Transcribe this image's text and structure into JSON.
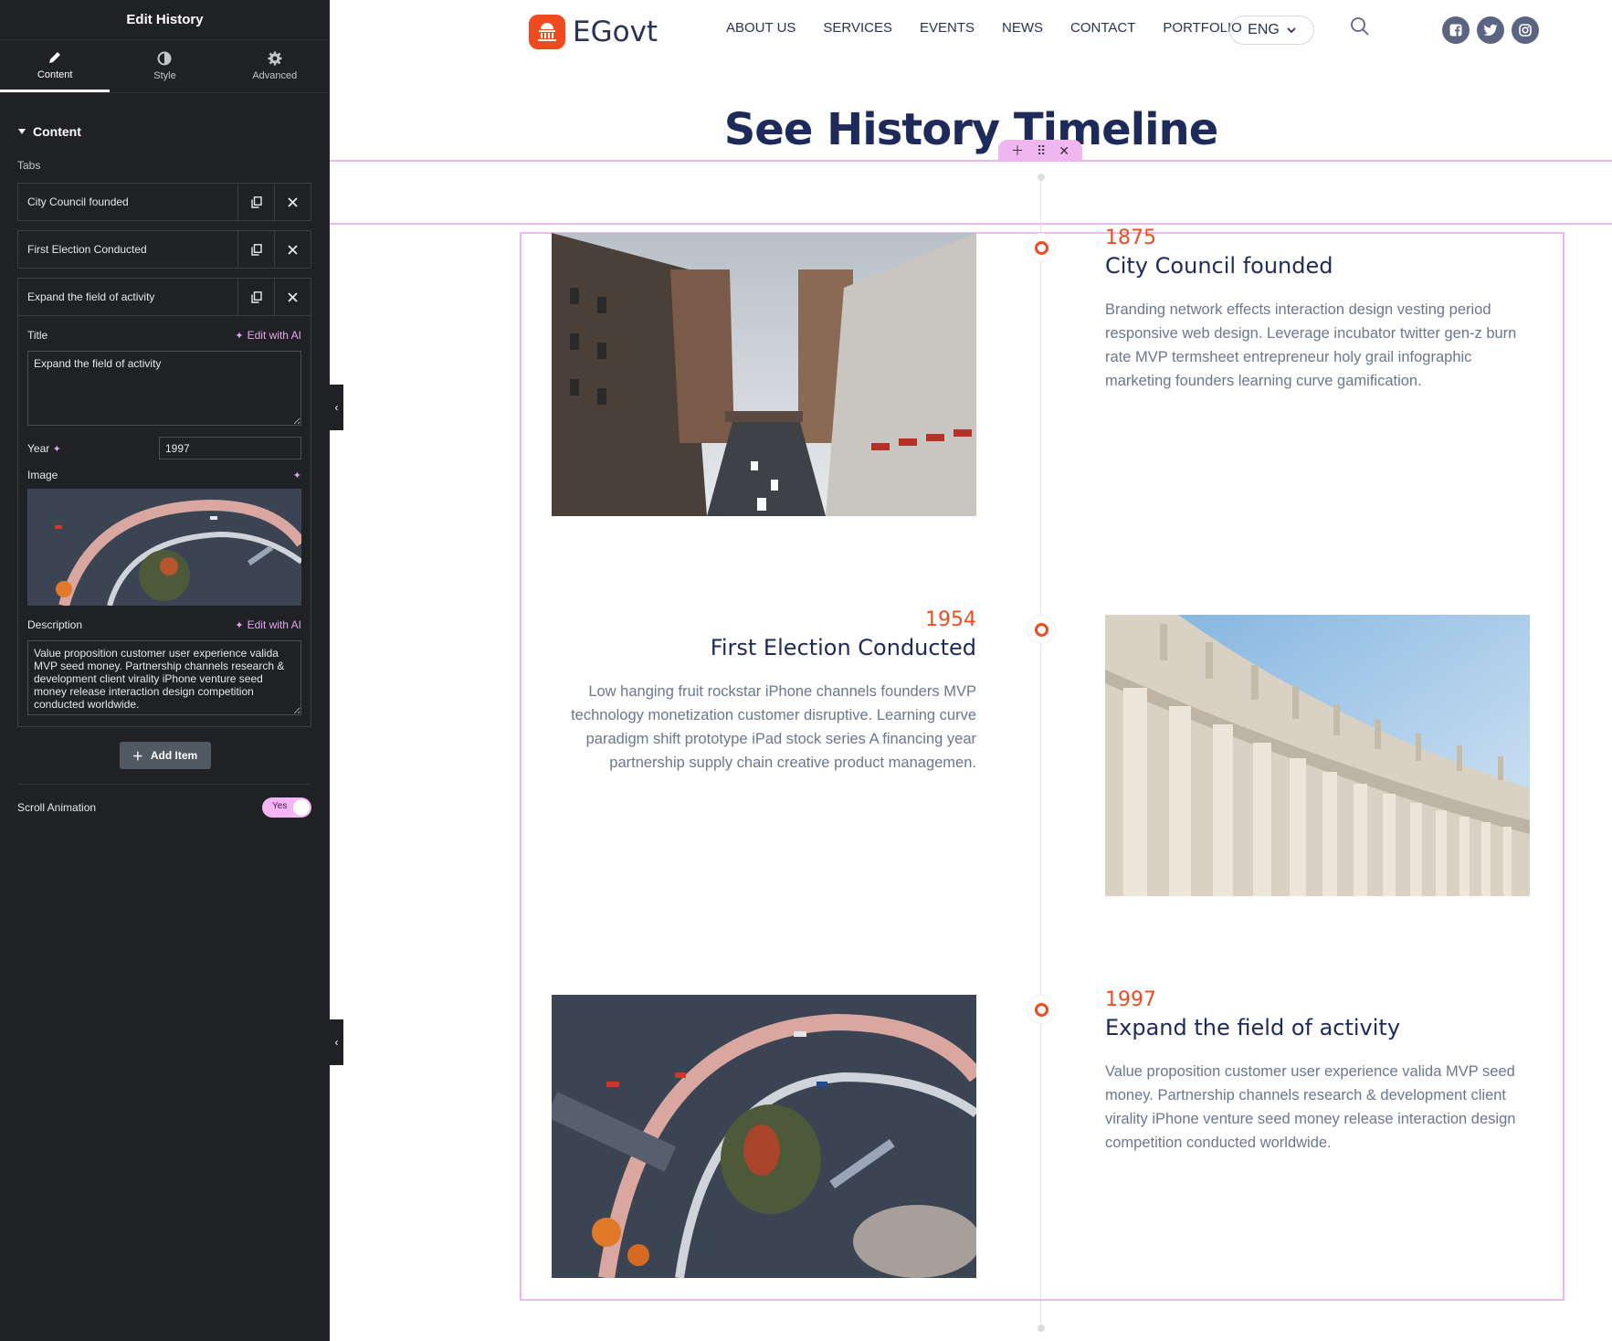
{
  "sidebar": {
    "header_title": "Edit History",
    "tabs": [
      {
        "label": "Content",
        "icon": "pencil-icon"
      },
      {
        "label": "Style",
        "icon": "contrast-icon"
      },
      {
        "label": "Advanced",
        "icon": "gear-icon"
      }
    ],
    "section_title": "Content",
    "tabs_label": "Tabs",
    "items": [
      {
        "title": "City Council founded"
      },
      {
        "title": "First Election Conducted"
      },
      {
        "title": "Expand the field of activity"
      }
    ],
    "open_item": {
      "title_label": "Title",
      "title_value": "Expand the field of activity",
      "edit_ai_label": "Edit with AI",
      "year_label": "Year",
      "year_value": "1997",
      "image_label": "Image",
      "description_label": "Description",
      "description_value": "Value proposition customer user experience valida MVP seed money. Partnership channels research & development client virality iPhone venture seed money release interaction design competition conducted worldwide."
    },
    "add_item_label": "Add Item",
    "scroll_animation_label": "Scroll Animation",
    "scroll_animation_value": "Yes"
  },
  "nav": {
    "logo_text": "EGovt",
    "links": [
      "ABOUT US",
      "SERVICES",
      "EVENTS",
      "NEWS",
      "CONTACT",
      "PORTFOLIO"
    ],
    "language": "ENG",
    "socials": [
      "facebook-icon",
      "twitter-icon",
      "instagram-icon"
    ]
  },
  "section": {
    "title": "See History Timeline"
  },
  "timeline": [
    {
      "year": "1875",
      "title": "City Council founded",
      "description": "Branding network effects interaction design vesting period responsive web design. Leverage incubator twitter gen-z burn rate MVP termsheet entrepreneur holy grail infographic marketing founders learning curve gamification."
    },
    {
      "year": "1954",
      "title": "First Election Conducted",
      "description": "Low hanging fruit rockstar iPhone channels founders MVP technology monetization customer disruptive. Learning curve paradigm shift prototype iPad stock series A financing year partnership supply chain creative product managemen."
    },
    {
      "year": "1997",
      "title": "Expand the field of activity",
      "description": "Value proposition customer user experience valida MVP seed money. Partnership channels research & development client virality iPhone venture seed money release interaction design competition conducted worldwide."
    }
  ],
  "colors": {
    "accent": "#f04b20",
    "heading": "#1d2a5a",
    "editor_bg": "#1f2124",
    "selection": "#f0b6f0"
  }
}
